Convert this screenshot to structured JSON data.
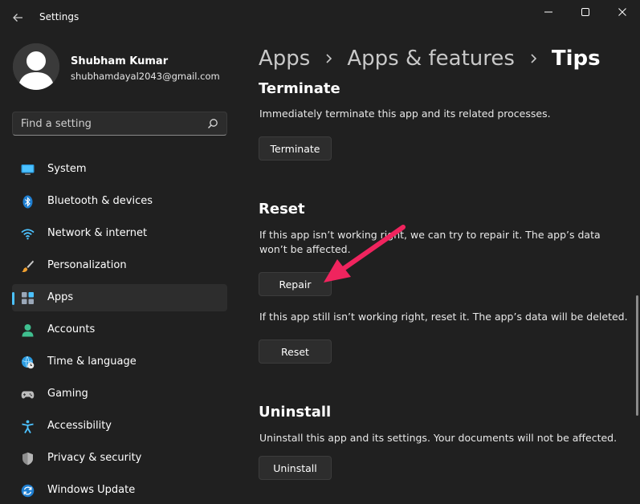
{
  "window": {
    "title": "Settings",
    "controls": [
      "minimize",
      "maximize",
      "close"
    ]
  },
  "profile": {
    "name": "Shubham Kumar",
    "email": "shubhamdayal2043@gmail.com"
  },
  "search": {
    "placeholder": "Find a setting"
  },
  "sidebar": {
    "items": [
      {
        "label": "System",
        "icon": "monitor-icon",
        "active": false
      },
      {
        "label": "Bluetooth & devices",
        "icon": "bluetooth-icon",
        "active": false
      },
      {
        "label": "Network & internet",
        "icon": "wifi-icon",
        "active": false
      },
      {
        "label": "Personalization",
        "icon": "brush-icon",
        "active": false
      },
      {
        "label": "Apps",
        "icon": "apps-icon",
        "active": true
      },
      {
        "label": "Accounts",
        "icon": "person-icon",
        "active": false
      },
      {
        "label": "Time & language",
        "icon": "globe-clock-icon",
        "active": false
      },
      {
        "label": "Gaming",
        "icon": "gamepad-icon",
        "active": false
      },
      {
        "label": "Accessibility",
        "icon": "accessibility-icon",
        "active": false
      },
      {
        "label": "Privacy & security",
        "icon": "shield-icon",
        "active": false
      },
      {
        "label": "Windows Update",
        "icon": "update-icon",
        "active": false
      }
    ]
  },
  "breadcrumb": {
    "items": [
      "Apps",
      "Apps & features",
      "Tips"
    ]
  },
  "main": {
    "terminate": {
      "heading": "Terminate",
      "description": "Immediately terminate this app and its related processes.",
      "button": "Terminate"
    },
    "reset": {
      "heading": "Reset",
      "repair_description": "If this app isn’t working right, we can try to repair it. The app’s data won’t be affected.",
      "repair_button": "Repair",
      "reset_description": "If this app still isn’t working right, reset it. The app’s data will be deleted.",
      "reset_button": "Reset"
    },
    "uninstall": {
      "heading": "Uninstall",
      "description": "Uninstall this app and its settings. Your documents will not be affected.",
      "button": "Uninstall"
    }
  },
  "colors": {
    "background": "#202020",
    "accent": "#4cc2ff",
    "annotation_arrow": "#f0245e"
  }
}
